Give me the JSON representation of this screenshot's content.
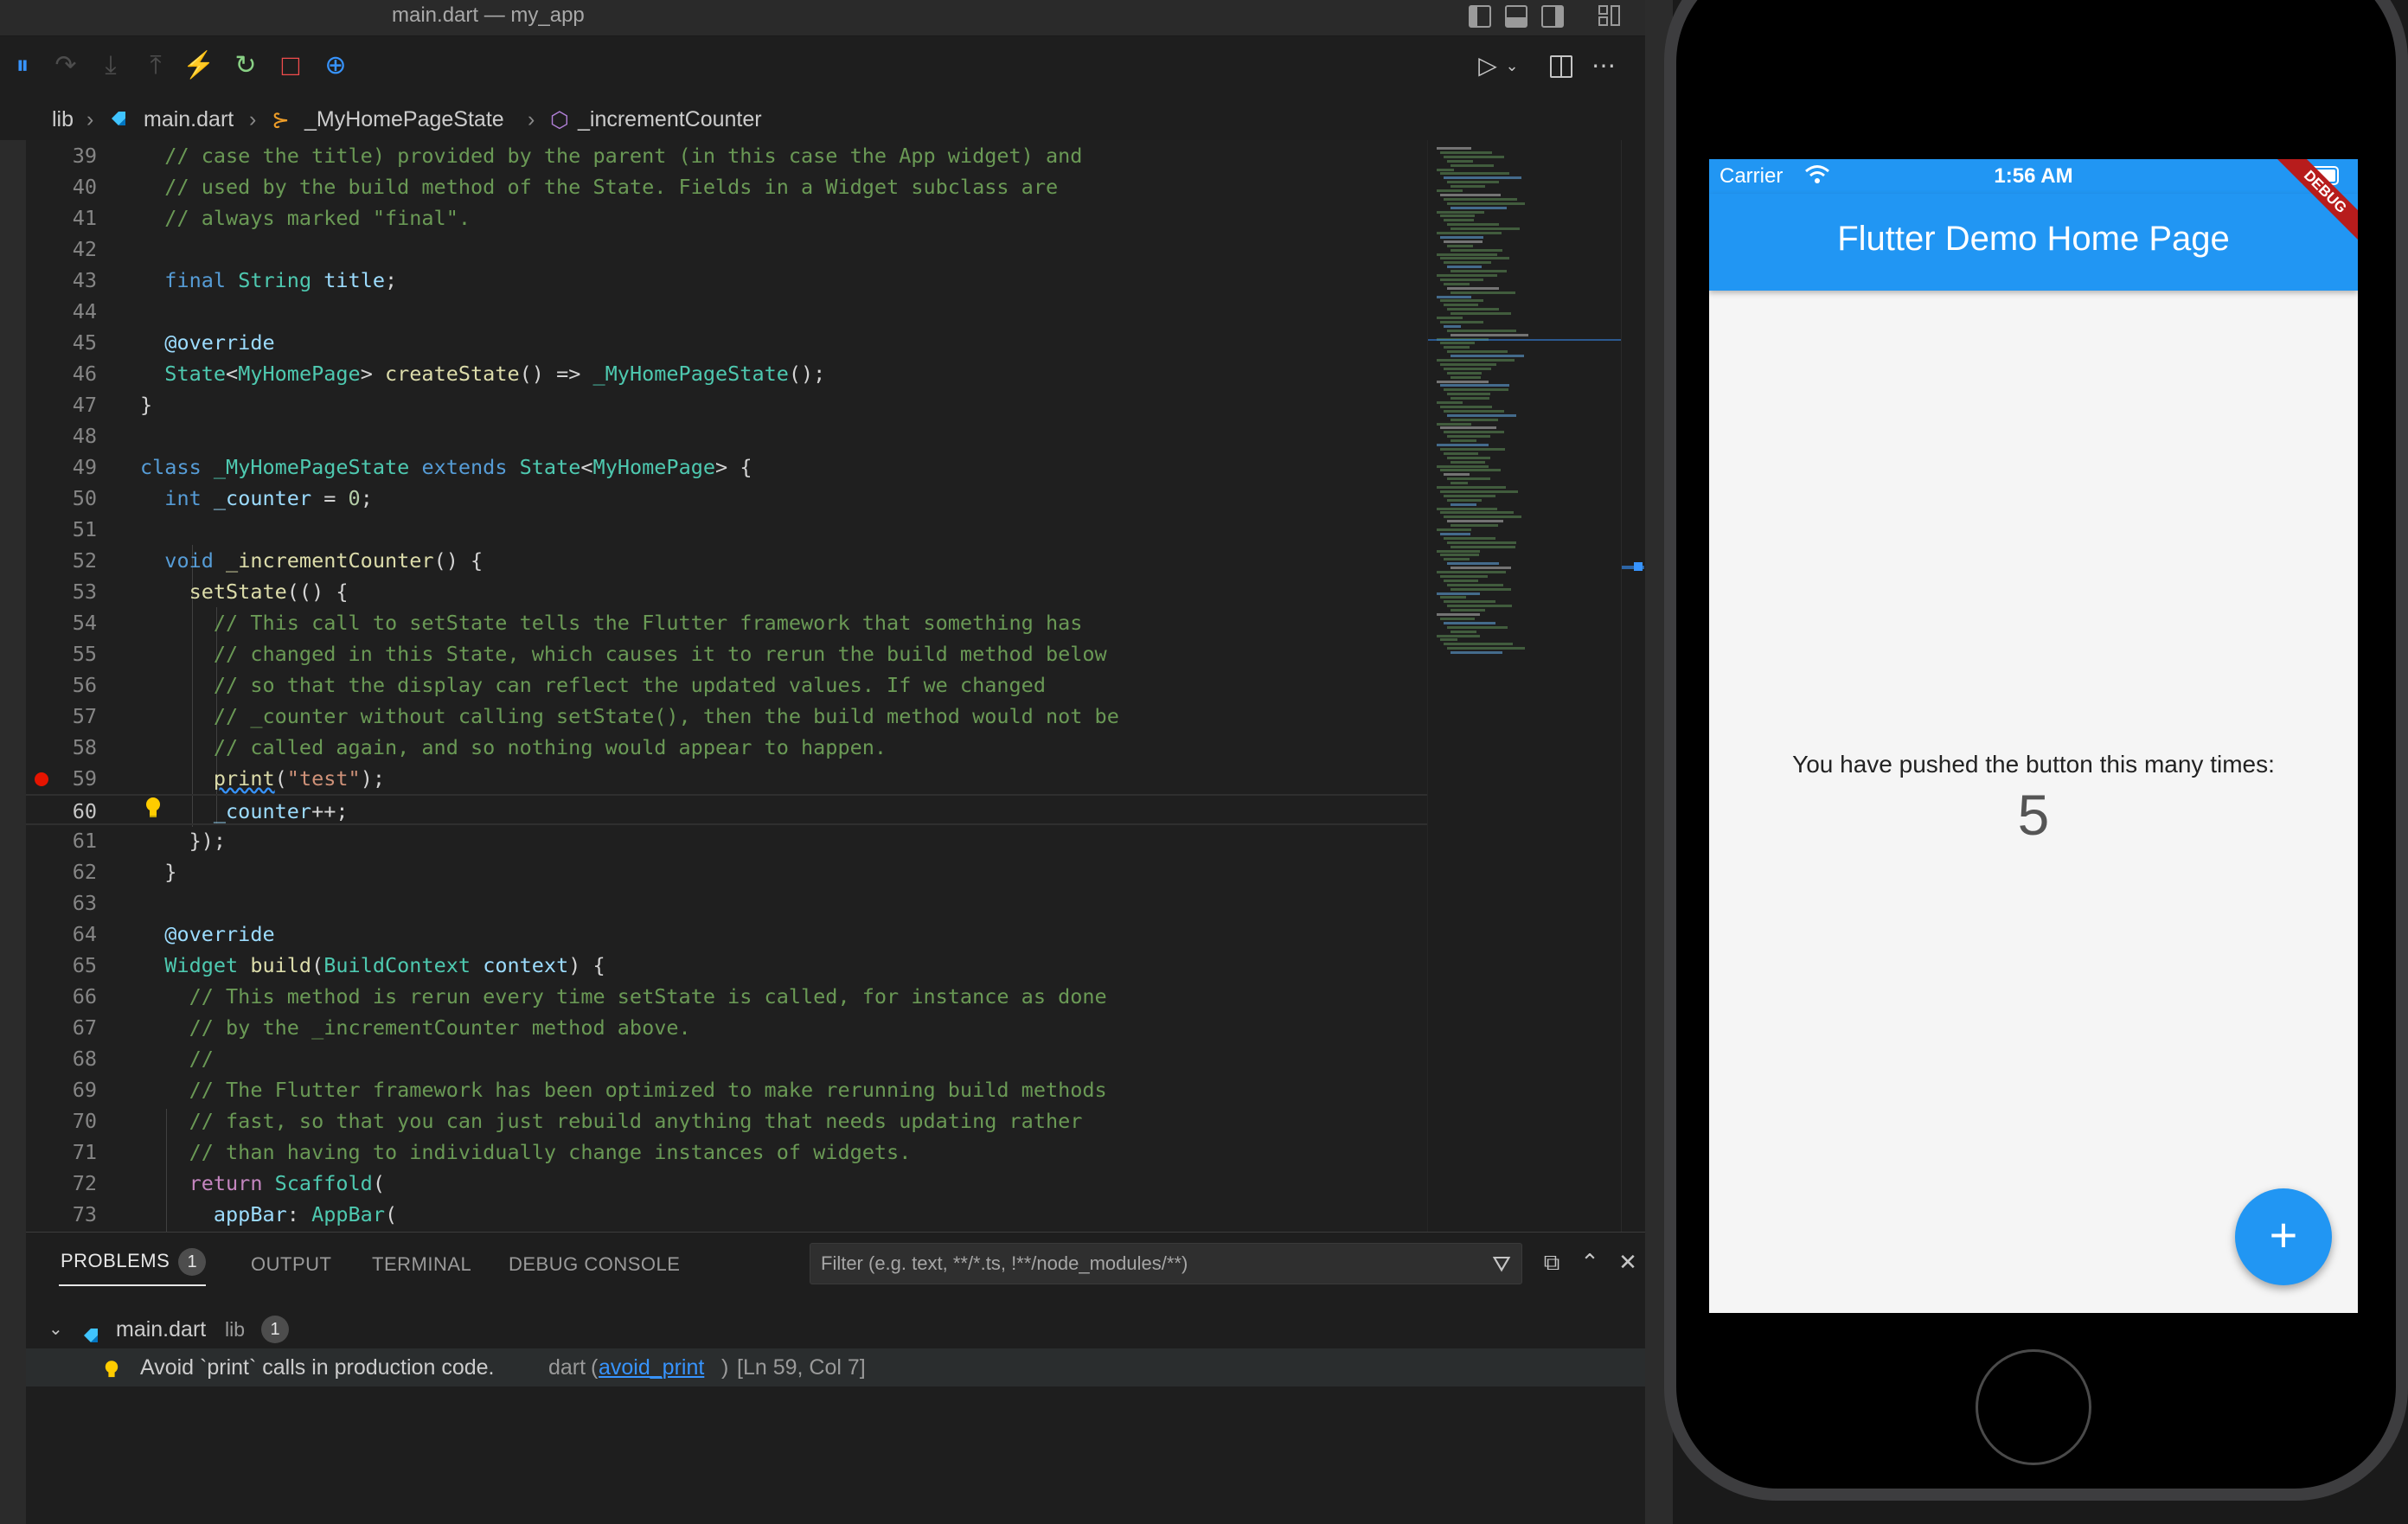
{
  "window": {
    "title": "main.dart — my_app"
  },
  "debug_toolbar": {
    "buttons": [
      {
        "name": "pause",
        "glyph": "⏸",
        "color": "#3794ff"
      },
      {
        "name": "step-over",
        "glyph": "↷",
        "color": "#4d4d4d"
      },
      {
        "name": "step-into",
        "glyph": "⤓",
        "color": "#4d4d4d"
      },
      {
        "name": "step-out",
        "glyph": "⤒",
        "color": "#4d4d4d"
      },
      {
        "name": "hot-reload",
        "glyph": "⚡",
        "color": "#e6c229"
      },
      {
        "name": "restart",
        "glyph": "↻",
        "color": "#89d185"
      },
      {
        "name": "stop",
        "glyph": "□",
        "color": "#f14c4c"
      },
      {
        "name": "inspect",
        "glyph": "⊕",
        "color": "#3794ff"
      }
    ]
  },
  "breadcrumb": {
    "folder": "lib",
    "file": "main.dart",
    "class": "_MyHomePageState",
    "method": "_incrementCounter",
    "separator": "›"
  },
  "editor": {
    "current_line": 60,
    "breakpoint_line": 59,
    "lines": [
      {
        "n": "39",
        "tokens": [
          [
            "c-com",
            "  // case the title) provided by the parent (in this case the App widget) and"
          ]
        ]
      },
      {
        "n": "40",
        "tokens": [
          [
            "c-com",
            "  // used by the build method of the State. Fields in a Widget subclass are"
          ]
        ]
      },
      {
        "n": "41",
        "tokens": [
          [
            "c-com",
            "  // always marked \"final\"."
          ]
        ]
      },
      {
        "n": "42",
        "tokens": []
      },
      {
        "n": "43",
        "tokens": [
          [
            "c-plain",
            "  "
          ],
          [
            "c-kw",
            "final"
          ],
          [
            "c-plain",
            " "
          ],
          [
            "c-type",
            "String"
          ],
          [
            "c-plain",
            " "
          ],
          [
            "c-var",
            "title"
          ],
          [
            "c-plain",
            ";"
          ]
        ]
      },
      {
        "n": "44",
        "tokens": []
      },
      {
        "n": "45",
        "tokens": [
          [
            "c-plain",
            "  "
          ],
          [
            "c-var",
            "@override"
          ]
        ]
      },
      {
        "n": "46",
        "tokens": [
          [
            "c-plain",
            "  "
          ],
          [
            "c-type",
            "State"
          ],
          [
            "c-plain",
            "<"
          ],
          [
            "c-type",
            "MyHomePage"
          ],
          [
            "c-plain",
            "> "
          ],
          [
            "c-fn",
            "createState"
          ],
          [
            "c-plain",
            "() => "
          ],
          [
            "c-type",
            "_MyHomePageState"
          ],
          [
            "c-plain",
            "();"
          ]
        ]
      },
      {
        "n": "47",
        "tokens": [
          [
            "c-plain",
            "}"
          ]
        ]
      },
      {
        "n": "48",
        "tokens": []
      },
      {
        "n": "49",
        "tokens": [
          [
            "c-kw",
            "class"
          ],
          [
            "c-plain",
            " "
          ],
          [
            "c-type",
            "_MyHomePageState"
          ],
          [
            "c-plain",
            " "
          ],
          [
            "c-kw",
            "extends"
          ],
          [
            "c-plain",
            " "
          ],
          [
            "c-type",
            "State"
          ],
          [
            "c-plain",
            "<"
          ],
          [
            "c-type",
            "MyHomePage"
          ],
          [
            "c-plain",
            "> {"
          ]
        ]
      },
      {
        "n": "50",
        "tokens": [
          [
            "c-plain",
            "  "
          ],
          [
            "c-kw",
            "int"
          ],
          [
            "c-plain",
            " "
          ],
          [
            "c-var",
            "_counter"
          ],
          [
            "c-plain",
            " = "
          ],
          [
            "c-num",
            "0"
          ],
          [
            "c-plain",
            ";"
          ]
        ]
      },
      {
        "n": "51",
        "tokens": []
      },
      {
        "n": "52",
        "tokens": [
          [
            "c-plain",
            "  "
          ],
          [
            "c-kw",
            "void"
          ],
          [
            "c-plain",
            " "
          ],
          [
            "c-fn",
            "_incrementCounter"
          ],
          [
            "c-plain",
            "() {"
          ]
        ]
      },
      {
        "n": "53",
        "tokens": [
          [
            "c-plain",
            "    "
          ],
          [
            "c-fn",
            "setState"
          ],
          [
            "c-plain",
            "(() {"
          ]
        ]
      },
      {
        "n": "54",
        "tokens": [
          [
            "c-com",
            "      // This call to setState tells the Flutter framework that something has"
          ]
        ]
      },
      {
        "n": "55",
        "tokens": [
          [
            "c-com",
            "      // changed in this State, which causes it to rerun the build method below"
          ]
        ]
      },
      {
        "n": "56",
        "tokens": [
          [
            "c-com",
            "      // so that the display can reflect the updated values. If we changed"
          ]
        ]
      },
      {
        "n": "57",
        "tokens": [
          [
            "c-com",
            "      // _counter without calling setState(), then the build method would not be"
          ]
        ]
      },
      {
        "n": "58",
        "tokens": [
          [
            "c-com",
            "      // called again, and so nothing would appear to happen."
          ]
        ]
      },
      {
        "n": "59",
        "tokens": [
          [
            "c-plain",
            "      "
          ],
          [
            "c-fn",
            "print"
          ],
          [
            "c-plain",
            "("
          ],
          [
            "c-str",
            "\"test\""
          ],
          [
            "c-plain",
            ");"
          ]
        ]
      },
      {
        "n": "60",
        "tokens": [
          [
            "c-plain",
            "      "
          ],
          [
            "c-var",
            "_counter"
          ],
          [
            "c-plain",
            "++;"
          ]
        ]
      },
      {
        "n": "61",
        "tokens": [
          [
            "c-plain",
            "    });"
          ]
        ]
      },
      {
        "n": "62",
        "tokens": [
          [
            "c-plain",
            "  }"
          ]
        ]
      },
      {
        "n": "63",
        "tokens": []
      },
      {
        "n": "64",
        "tokens": [
          [
            "c-plain",
            "  "
          ],
          [
            "c-var",
            "@override"
          ]
        ]
      },
      {
        "n": "65",
        "tokens": [
          [
            "c-plain",
            "  "
          ],
          [
            "c-type",
            "Widget"
          ],
          [
            "c-plain",
            " "
          ],
          [
            "c-fn",
            "build"
          ],
          [
            "c-plain",
            "("
          ],
          [
            "c-type",
            "BuildContext"
          ],
          [
            "c-plain",
            " "
          ],
          [
            "c-var",
            "context"
          ],
          [
            "c-plain",
            ") {"
          ]
        ]
      },
      {
        "n": "66",
        "tokens": [
          [
            "c-com",
            "    // This method is rerun every time setState is called, for instance as done"
          ]
        ]
      },
      {
        "n": "67",
        "tokens": [
          [
            "c-com",
            "    // by the _incrementCounter method above."
          ]
        ]
      },
      {
        "n": "68",
        "tokens": [
          [
            "c-com",
            "    //"
          ]
        ]
      },
      {
        "n": "69",
        "tokens": [
          [
            "c-com",
            "    // The Flutter framework has been optimized to make rerunning build methods"
          ]
        ]
      },
      {
        "n": "70",
        "tokens": [
          [
            "c-com",
            "    // fast, so that you can just rebuild anything that needs updating rather"
          ]
        ]
      },
      {
        "n": "71",
        "tokens": [
          [
            "c-com",
            "    // than having to individually change instances of widgets."
          ]
        ]
      },
      {
        "n": "72",
        "tokens": [
          [
            "c-plain",
            "    "
          ],
          [
            "c-ctl",
            "return"
          ],
          [
            "c-plain",
            " "
          ],
          [
            "c-type",
            "Scaffold"
          ],
          [
            "c-plain",
            "("
          ]
        ]
      },
      {
        "n": "73",
        "tokens": [
          [
            "c-plain",
            "      "
          ],
          [
            "c-var",
            "appBar"
          ],
          [
            "c-plain",
            ": "
          ],
          [
            "c-type",
            "AppBar"
          ],
          [
            "c-plain",
            "("
          ]
        ]
      }
    ]
  },
  "panel": {
    "tabs": [
      {
        "label": "PROBLEMS",
        "badge": "1",
        "active": true
      },
      {
        "label": "OUTPUT"
      },
      {
        "label": "TERMINAL"
      },
      {
        "label": "DEBUG CONSOLE"
      }
    ],
    "filter_placeholder": "Filter (e.g. text, **/*.ts, !**/node_modules/**)",
    "problems": {
      "file": "main.dart",
      "folder": "lib",
      "count": "1",
      "message": "Avoid `print` calls in production code.",
      "source": "dart",
      "code": "avoid_print",
      "location": "[Ln 59, Col 7]"
    }
  },
  "simulator": {
    "status": {
      "carrier": "Carrier",
      "time": "1:56 AM"
    },
    "debug_banner": "DEBUG",
    "appbar_title": "Flutter Demo Home Page",
    "counter_label": "You have pushed the button this many times:",
    "counter_value": "5",
    "fab_glyph": "+"
  },
  "colors": {
    "accent": "#2196f3",
    "breakpoint": "#e51400",
    "editor_bg": "#1e1e1e"
  }
}
